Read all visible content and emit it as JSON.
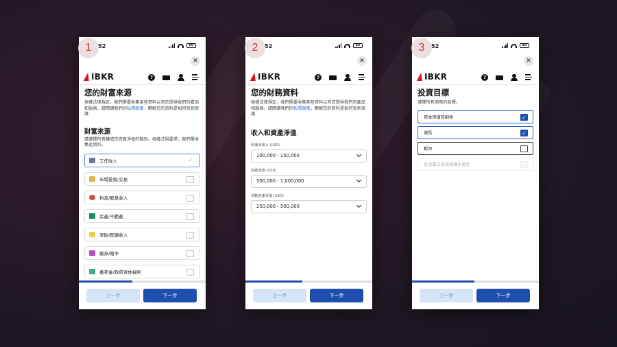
{
  "background": {
    "colors": [
      "#3a1f2e",
      "#181420"
    ]
  },
  "accent": "#1f4fae",
  "brand_red": "#d81222",
  "screens": [
    {
      "badge": "1",
      "status_time": "52",
      "battery": "80",
      "brand": "IBKR",
      "title": "您的財富來源",
      "desc_pre": "根據法律規定，我們需要收集某些資料以向您提供我們的產品和服務。請閱讀我們的",
      "desc_link": "私隱政策",
      "desc_post": "，瞭解您的資料是如何受到保護",
      "section": "財富來源",
      "section_desc": "請選擇所有構成您資產淨值的類別。根據法規要求，我們需收集此資料。",
      "options": [
        {
          "label": "工作收入",
          "icon": "briefcase-icon",
          "color": "#6b7a99",
          "selected": true
        },
        {
          "label": "市場投資/交易",
          "icon": "chart-icon",
          "color": "#e0b84a",
          "selected": false
        },
        {
          "label": "利息/股息收入",
          "icon": "pie-icon",
          "color": "#d94a4a",
          "selected": false
        },
        {
          "label": "房產/不動產",
          "icon": "house-icon",
          "color": "#1f8a5b",
          "selected": false
        },
        {
          "label": "津貼/配偶收入",
          "icon": "wallet-icon",
          "color": "#f0cf3d",
          "selected": false
        },
        {
          "label": "繼承/贈予",
          "icon": "gift-icon",
          "color": "#b14fc9",
          "selected": false
        },
        {
          "label": "養老金/政府退休福利",
          "icon": "pension-icon",
          "color": "#3bb37a",
          "selected": false
        }
      ],
      "progress": 0.42,
      "back": "上一步",
      "next": "下一步"
    },
    {
      "badge": "2",
      "status_time": "52",
      "battery": "80",
      "brand": "IBKR",
      "title": "您的財務資料",
      "desc_pre": "根據法律規定，我們需要收集某些資料以向您提供我們的產品和服務。請閱讀我們的",
      "desc_link": "私隱政策",
      "desc_post": "，瞭解您的資料是如何受到保護",
      "section": "收入和資產淨值",
      "fields": [
        {
          "label": "年度淨收入 (USD)",
          "value": "100,000 - 150,000"
        },
        {
          "label": "資產淨值 (USD)",
          "value": "500,000 - 1,000,000"
        },
        {
          "label": "流動資產淨值 (USD)",
          "value": "250,000 - 500,000"
        }
      ],
      "progress": 0.45,
      "back": "上一步",
      "next": "下一步"
    },
    {
      "badge": "3",
      "status_time": "52",
      "battery": "80",
      "brand": "IBKR",
      "title": "投資目標",
      "subtitle": "選擇所有適用的目標。",
      "goals": [
        {
          "label": "資本保值及創收",
          "state": "on"
        },
        {
          "label": "增長",
          "state": "on"
        },
        {
          "label": "對沖",
          "state": "focus"
        },
        {
          "label": "從活躍交易和投機中盈利",
          "state": "dim"
        }
      ],
      "progress": 0.49,
      "back": "上一步",
      "next": "下一步"
    }
  ]
}
